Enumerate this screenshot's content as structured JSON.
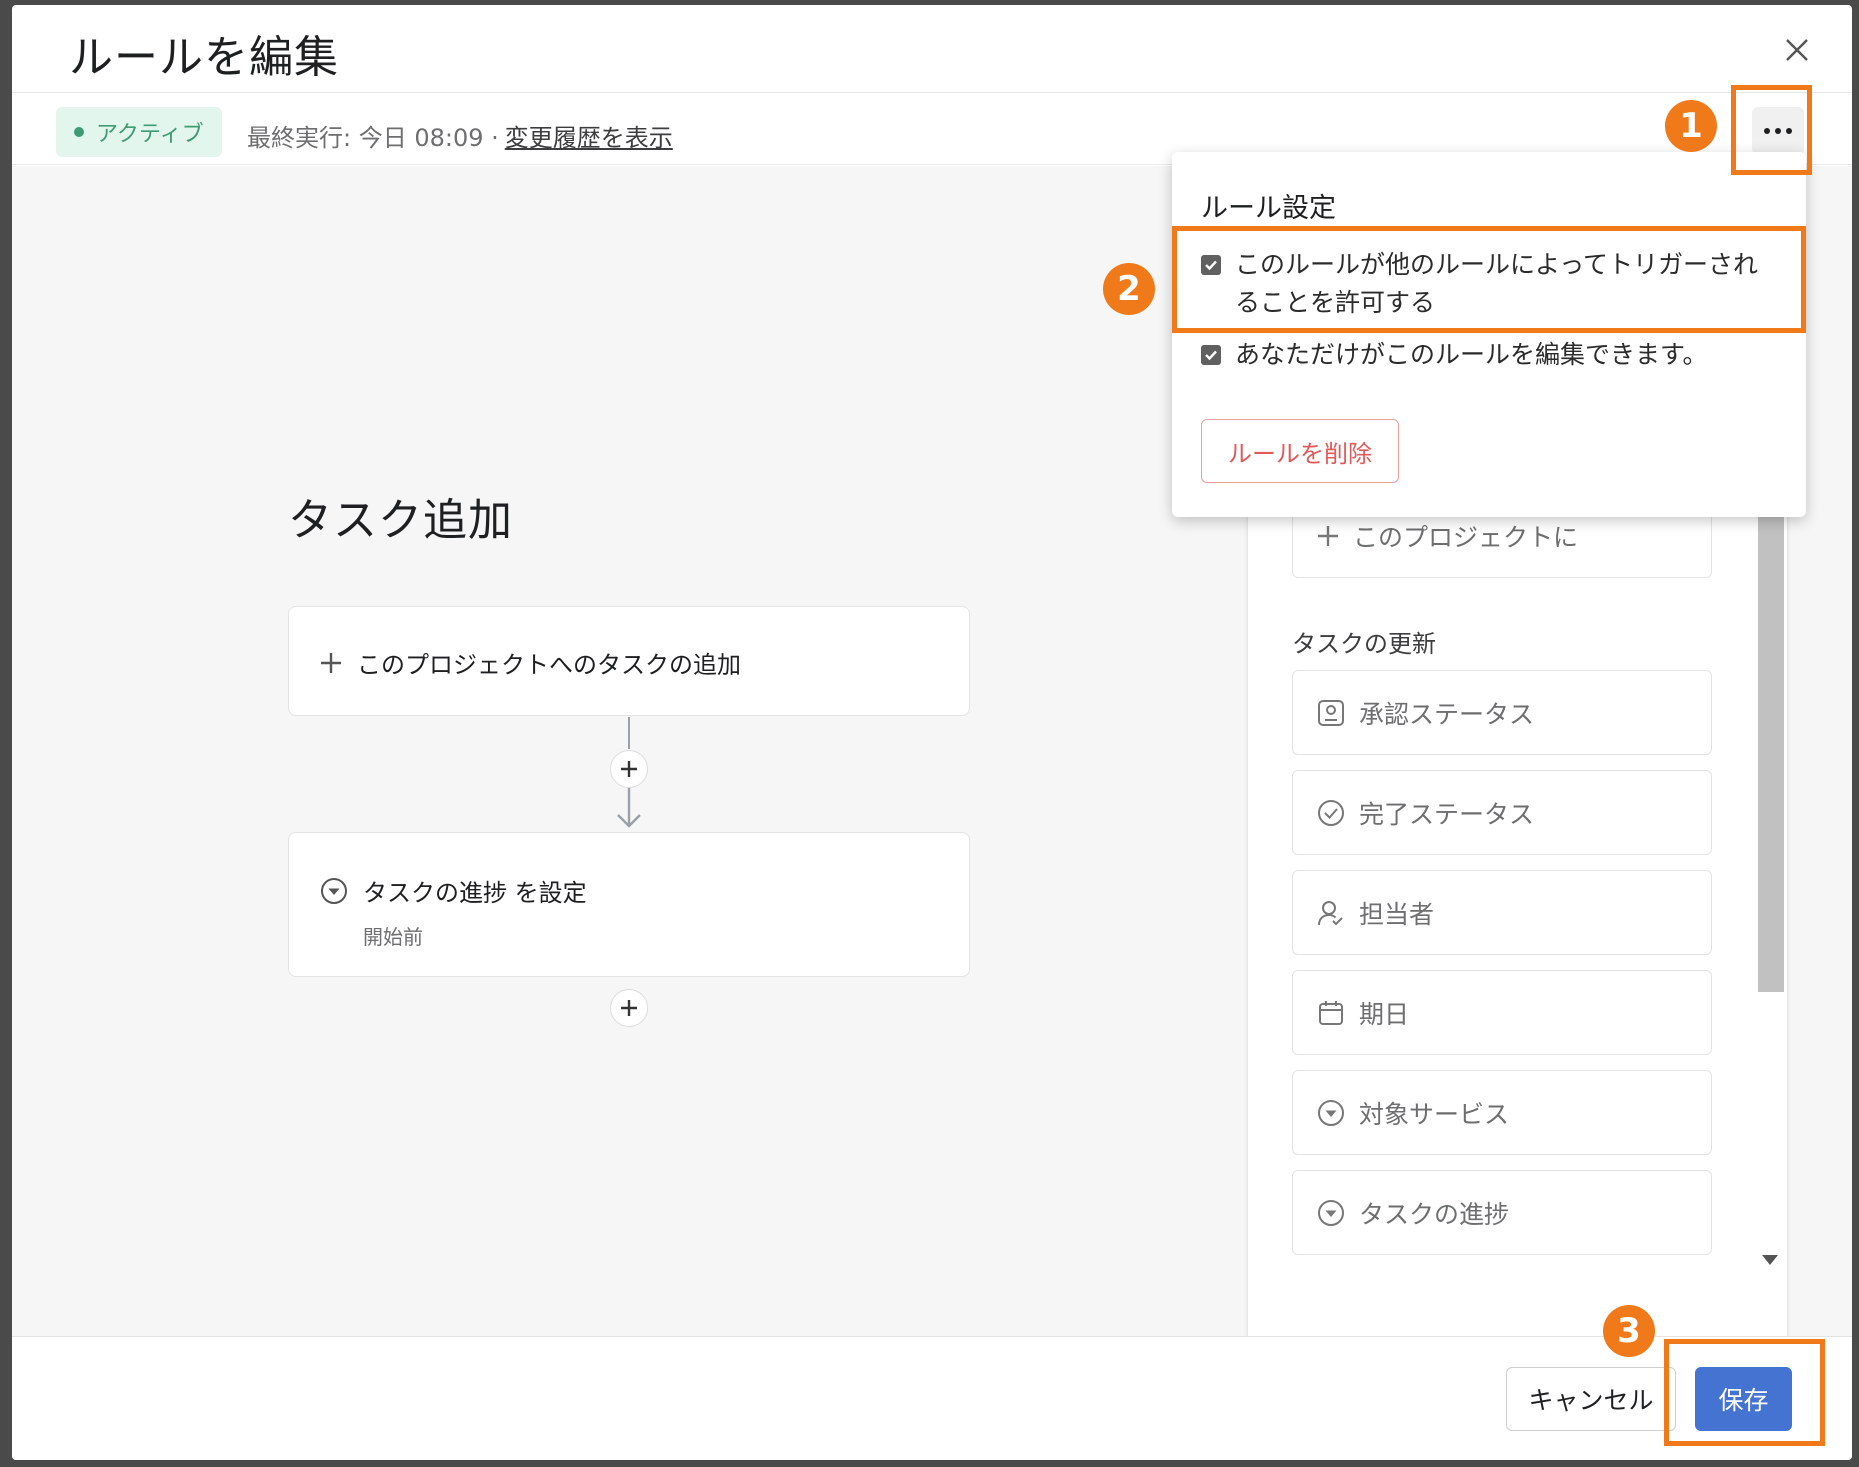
{
  "modal": {
    "title": "ルールを編集",
    "status": "アクティブ",
    "last_run": "最終実行: 今日 08:09 ·",
    "history_link": "変更履歴を表示"
  },
  "canvas": {
    "section_title": "タスク追加",
    "trigger_label": "このプロジェクトへのタスクの追加",
    "action_label": "タスクの進捗 を設定",
    "action_value": "開始前"
  },
  "side_panel": {
    "partial_item": "このプロジェクトに",
    "heading": "タスクの更新",
    "items": [
      {
        "label": "承認ステータス",
        "icon": "approval-icon"
      },
      {
        "label": "完了ステータス",
        "icon": "check-circle-icon"
      },
      {
        "label": "担当者",
        "icon": "assignee-icon"
      },
      {
        "label": "期日",
        "icon": "calendar-icon"
      },
      {
        "label": "対象サービス",
        "icon": "dropdown-field-icon"
      },
      {
        "label": "タスクの進捗",
        "icon": "dropdown-field-icon"
      }
    ]
  },
  "dropdown": {
    "title": "ルール設定",
    "option1_line1": "このルールが他のルールによってトリガーされ",
    "option1_line2": "ることを許可する",
    "option1_checked": true,
    "option2": "あなただけがこのルールを編集できます。",
    "option2_checked": true,
    "delete_label": "ルールを削除"
  },
  "footer": {
    "cancel_label": "キャンセル",
    "save_label": "保存"
  },
  "annotations": {
    "step1": "1",
    "step2": "2",
    "step3": "3",
    "color": "#f07a1a"
  },
  "colors": {
    "primary": "#4573d2",
    "active_green": "#3f9b74",
    "danger": "#e05a5a"
  }
}
